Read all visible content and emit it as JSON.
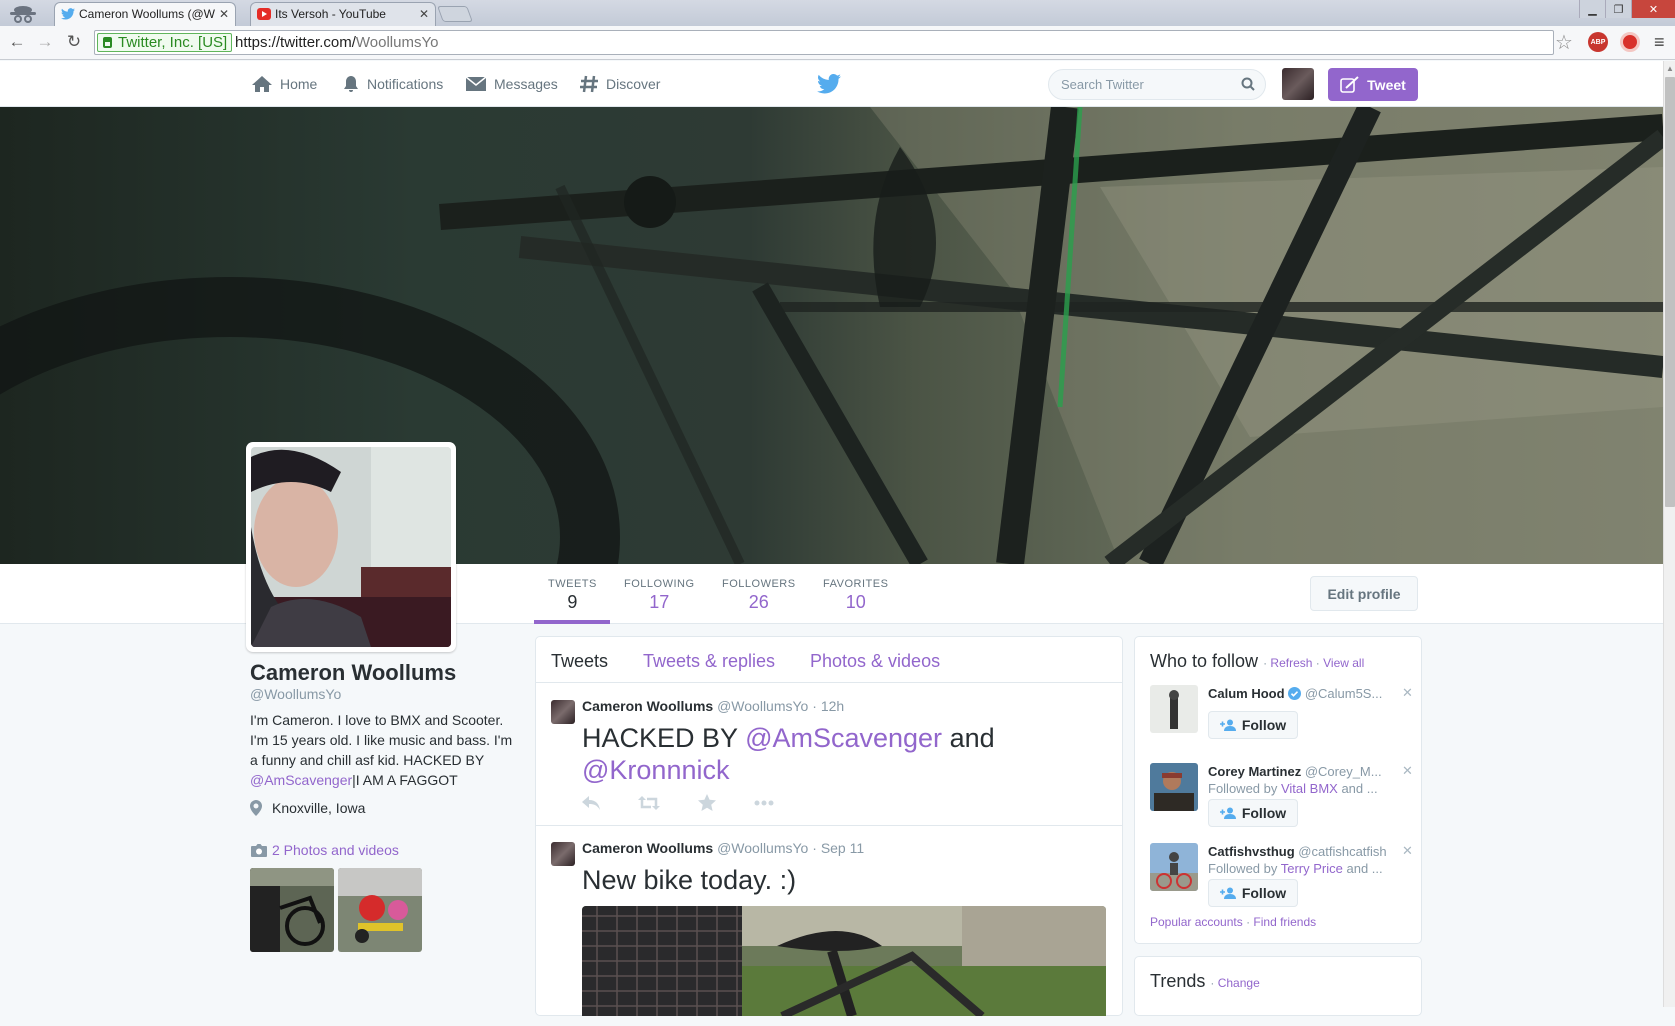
{
  "browser": {
    "tabs": [
      {
        "title": "Cameron Woollums (@W",
        "active": true
      },
      {
        "title": "Its Versoh - YouTube",
        "active": false
      }
    ],
    "ev_label": "Twitter, Inc. [US]",
    "url_main": "https://twitter.com/",
    "url_path": "WoollumsYo",
    "abp_label": "ABP"
  },
  "nav": {
    "home": "Home",
    "notifications": "Notifications",
    "messages": "Messages",
    "discover": "Discover",
    "search_placeholder": "Search Twitter",
    "tweet_button": "Tweet"
  },
  "profile": {
    "name": "Cameron Woollums",
    "handle": "@WoollumsYo",
    "bio_text": "I'm Cameron. I love to BMX and Scooter. I'm 15 years old. I like music and bass. I'm a funny and chill asf kid. HACKED BY ",
    "bio_link": "@AmScavenger",
    "bio_tail": "|I AM A FAGGOT",
    "location": "Knoxville, Iowa",
    "photos_label": "2 Photos and videos",
    "edit_button": "Edit profile"
  },
  "stats": [
    {
      "label": "TWEETS",
      "value": "9"
    },
    {
      "label": "FOLLOWING",
      "value": "17"
    },
    {
      "label": "FOLLOWERS",
      "value": "26"
    },
    {
      "label": "FAVORITES",
      "value": "10"
    }
  ],
  "timeline": {
    "tabs": [
      "Tweets",
      "Tweets & replies",
      "Photos & videos"
    ],
    "tweets": [
      {
        "name": "Cameron Woollums",
        "handle": "@WoollumsYo",
        "time": "12h",
        "text_a": "HACKED BY ",
        "mention1": "@AmScavenger",
        "text_b": " and ",
        "mention2": "@Kronnnick"
      },
      {
        "name": "Cameron Woollums",
        "handle": "@WoollumsYo",
        "time": "Sep 11",
        "text": "New bike today. :)"
      }
    ]
  },
  "who_to_follow": {
    "title": "Who to follow",
    "refresh": "Refresh",
    "view_all": "View all",
    "suggestions": [
      {
        "name": "Calum Hood",
        "handle": "@Calum5S...",
        "verified": true,
        "followed_by_prefix": "",
        "followed_by": ""
      },
      {
        "name": "Corey Martinez",
        "handle": "@Corey_M...",
        "verified": false,
        "followed_by_prefix": "Followed by ",
        "followed_by": "Vital BMX",
        "followed_by_suffix": " and ..."
      },
      {
        "name": "Catfishvsthug",
        "handle": "@catfishcatfish",
        "verified": false,
        "followed_by_prefix": "Followed by ",
        "followed_by": "Terry Price",
        "followed_by_suffix": " and ..."
      }
    ],
    "follow_label": "Follow",
    "popular": "Popular accounts",
    "find_friends": "Find friends"
  },
  "trends": {
    "title": "Trends",
    "change": "Change"
  },
  "colors": {
    "accent": "#9266cc",
    "text": "#292f33",
    "muted": "#8899a6",
    "background": "#f5f8fa"
  }
}
